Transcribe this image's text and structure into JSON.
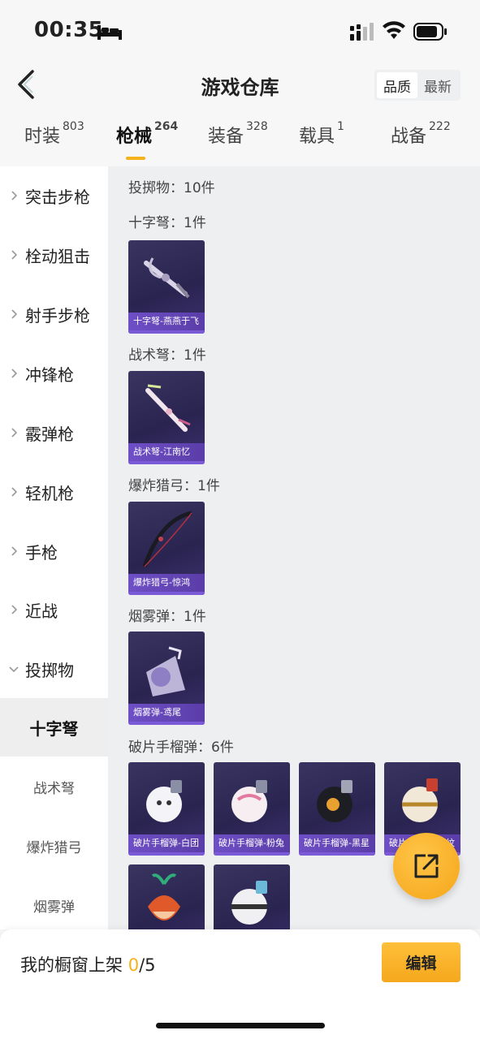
{
  "status_bar": {
    "time": "00:35"
  },
  "header": {
    "title": "游戏仓库",
    "sort_options": [
      "品质",
      "最新"
    ]
  },
  "tabs": [
    {
      "label": "时装",
      "count": "803"
    },
    {
      "label": "枪械",
      "count": "264"
    },
    {
      "label": "装备",
      "count": "328"
    },
    {
      "label": "载具",
      "count": "1"
    },
    {
      "label": "战备",
      "count": "222"
    }
  ],
  "sidebar": {
    "categories": [
      "突击步枪",
      "栓动狙击",
      "射手步枪",
      "冲锋枪",
      "霰弹枪",
      "轻机枪",
      "手枪",
      "近战",
      "投掷物"
    ],
    "subcategories": [
      "十字弩",
      "战术弩",
      "爆炸猎弓",
      "烟雾弹"
    ]
  },
  "content": {
    "total_label": "投掷物：10件",
    "sections": [
      {
        "label": "十字弩：1件",
        "items": [
          "十字弩-燕燕于飞"
        ]
      },
      {
        "label": "战术弩：1件",
        "items": [
          "战术弩-江南忆"
        ]
      },
      {
        "label": "爆炸猎弓：1件",
        "items": [
          "爆炸猎弓-惊鸿"
        ]
      },
      {
        "label": "烟雾弹：1件",
        "items": [
          "烟雾弹-鸢尾"
        ]
      },
      {
        "label": "破片手榴弹：6件",
        "items": [
          "破片手榴弹-白团",
          "破片手榴弹-粉兔",
          "破片手榴弹-黑星",
          "破片手榴弹-金纹",
          "",
          ""
        ]
      }
    ]
  },
  "bottom_bar": {
    "showcase_label": "我的橱窗上架",
    "showcase_current": "0",
    "showcase_total": "/5",
    "edit_label": "编辑"
  },
  "colors": {
    "accent": "#f5b21a",
    "card_bg": "#2e2856",
    "caption_bg": "#6f4fc6"
  }
}
